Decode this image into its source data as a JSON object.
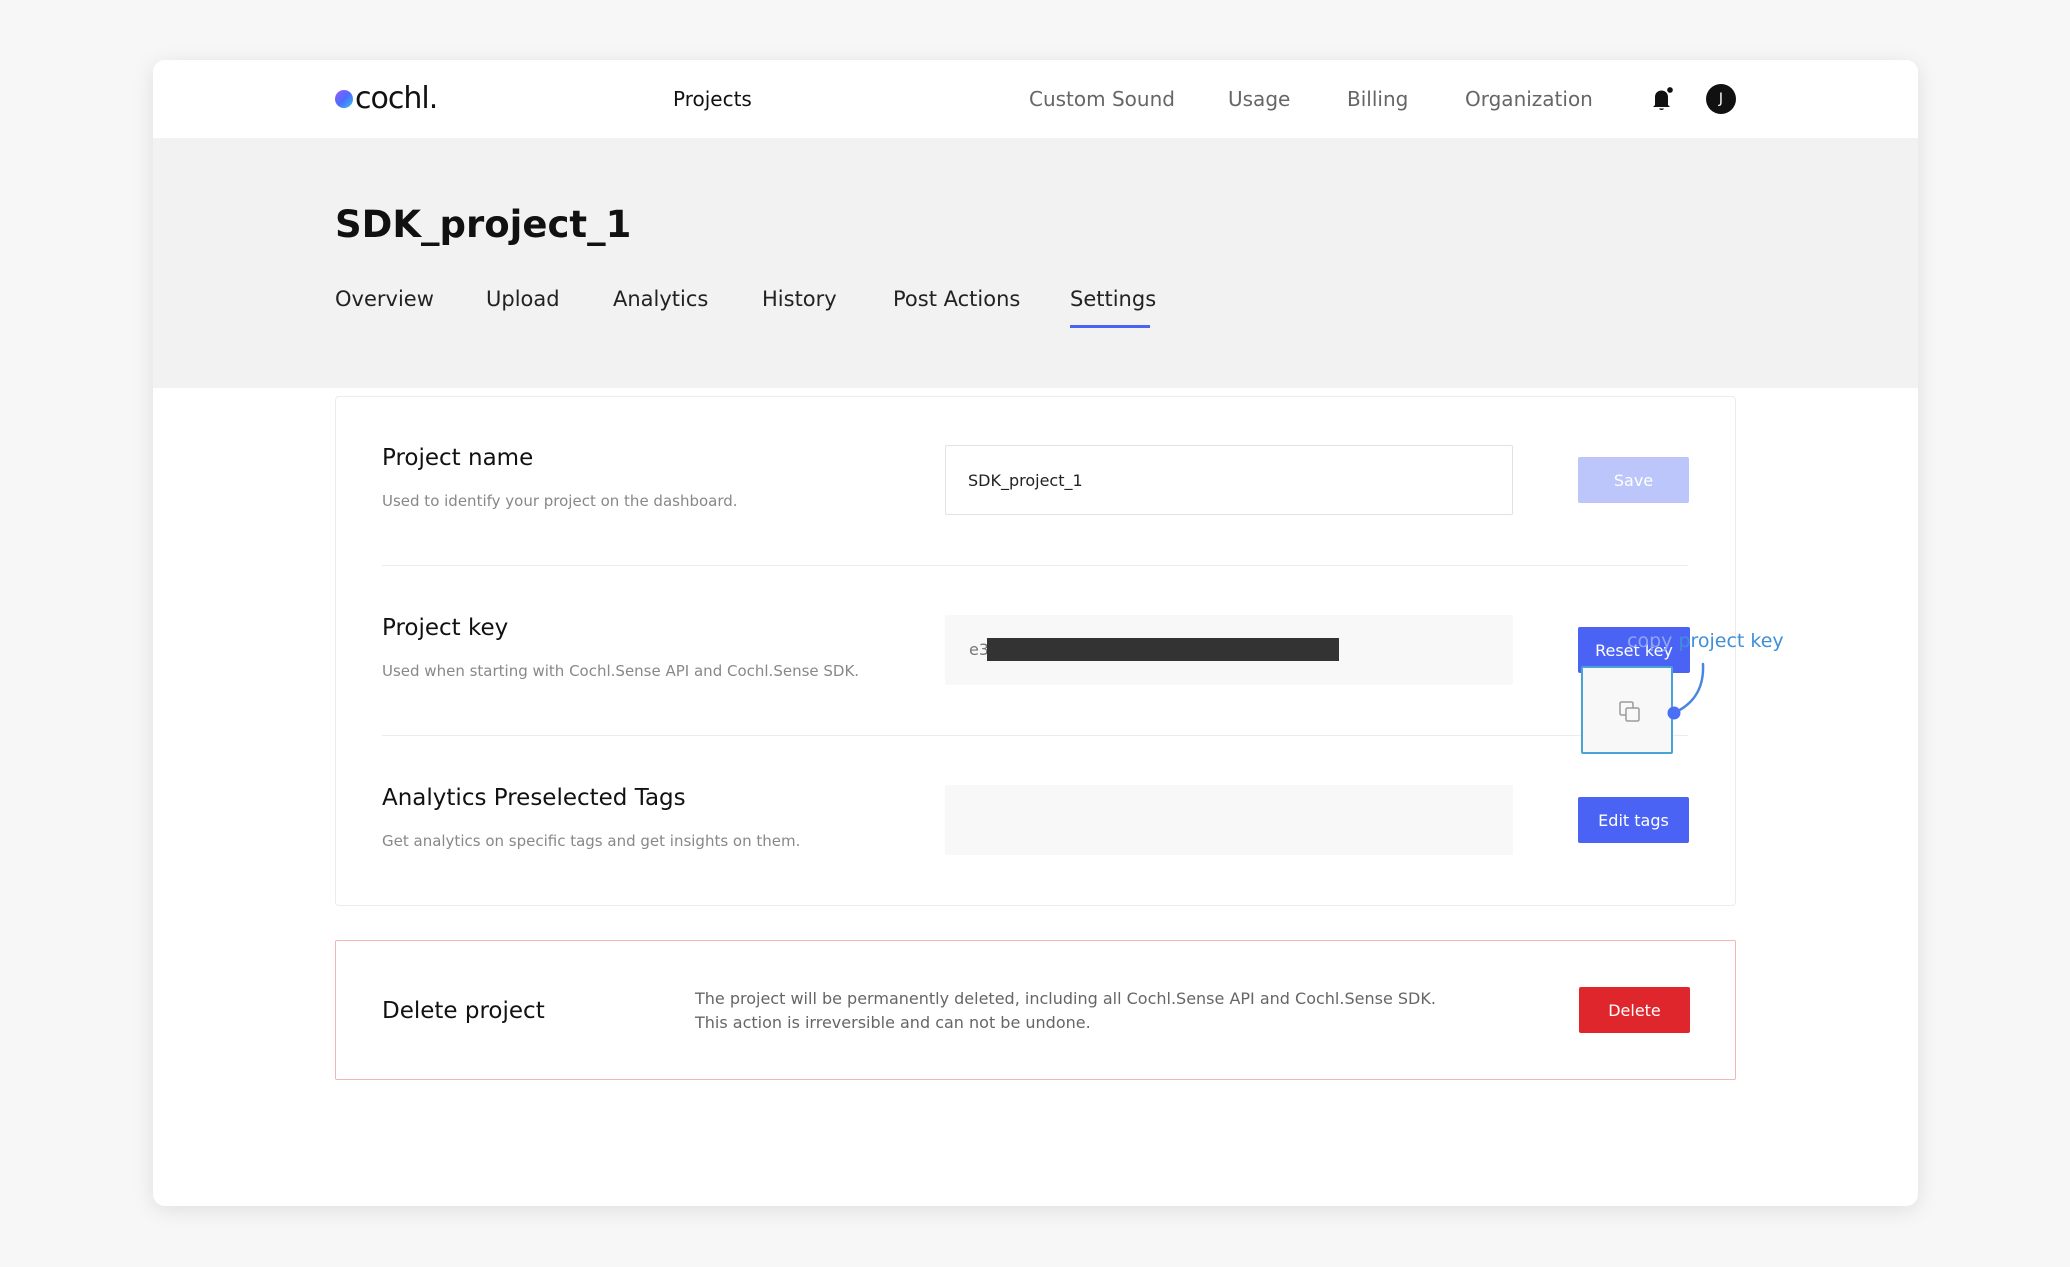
{
  "app": {
    "logo_text": "cochl."
  },
  "nav": {
    "items": [
      {
        "label": "Projects",
        "active": true
      },
      {
        "label": "Custom Sound",
        "active": false
      },
      {
        "label": "Usage",
        "active": false
      },
      {
        "label": "Billing",
        "active": false
      },
      {
        "label": "Organization",
        "active": false
      }
    ],
    "notifications_icon": "bell-icon",
    "user_initial": "J"
  },
  "project": {
    "title": "SDK_project_1",
    "tabs": [
      {
        "label": "Overview",
        "active": false
      },
      {
        "label": "Upload",
        "active": false
      },
      {
        "label": "Analytics",
        "active": false
      },
      {
        "label": "History",
        "active": false
      },
      {
        "label": "Post Actions",
        "active": false
      },
      {
        "label": "Settings",
        "active": true
      }
    ]
  },
  "settings": {
    "project_name": {
      "title": "Project name",
      "description": "Used to identify your project on the dashboard.",
      "value": "SDK_project_1",
      "save_label": "Save"
    },
    "project_key": {
      "title": "Project key",
      "description": "Used when starting with Cochl.Sense API and Cochl.Sense SDK.",
      "visible_prefix": "e3",
      "copy_icon": "copy-icon",
      "reset_label": "Reset key",
      "callout_part1": "copy",
      "callout_part2": "project key"
    },
    "tags": {
      "title": "Analytics Preselected Tags",
      "description": "Get analytics on specific tags and get insights on them.",
      "edit_label": "Edit tags"
    }
  },
  "danger": {
    "title": "Delete project",
    "description_line1": "The project will be permanently deleted, including all Cochl.Sense API and Cochl.Sense SDK.",
    "description_line2": "This action is irreversible and can not be undone.",
    "delete_label": "Delete"
  },
  "colors": {
    "accent": "#4a63f5",
    "accent_disabled": "#bcc6fb",
    "danger": "#e0262d",
    "danger_border": "#f0b7b3",
    "header_band": "#f2f2f2"
  }
}
